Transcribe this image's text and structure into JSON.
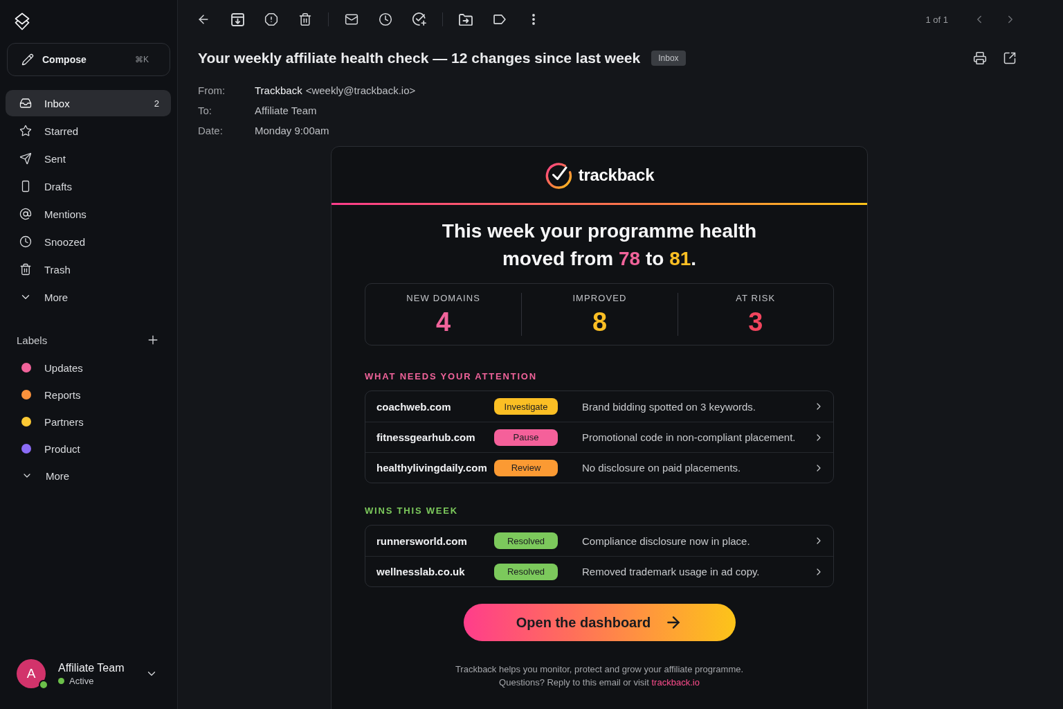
{
  "sidebar": {
    "compose": {
      "label": "Compose",
      "shortcut": "⌘K"
    },
    "nav": [
      {
        "label": "Inbox",
        "count": "2",
        "selected": true
      },
      {
        "label": "Starred",
        "selected": false
      },
      {
        "label": "Sent",
        "selected": false
      },
      {
        "label": "Drafts",
        "selected": false
      },
      {
        "label": "Mentions",
        "selected": false
      },
      {
        "label": "Snoozed",
        "selected": false
      },
      {
        "label": "Trash",
        "selected": false
      }
    ],
    "nav_more": "More",
    "labels_heading": "Labels",
    "labels": [
      {
        "label": "Updates",
        "color": "#f0639a"
      },
      {
        "label": "Reports",
        "color": "#fb923c"
      },
      {
        "label": "Partners",
        "color": "#fcc934"
      },
      {
        "label": "Product",
        "color": "#8b6cf6"
      }
    ],
    "labels_more": "More",
    "account": {
      "initial": "A",
      "name": "Affiliate Team",
      "status": "Active",
      "online": true
    }
  },
  "toolbar": {
    "pager": "1 of 1"
  },
  "message": {
    "subject": "Your weekly affiliate health check — 12 changes since last week",
    "folder_tag": "Inbox",
    "from": {
      "label": "From:",
      "name": "Trackback",
      "address": "<weekly@trackback.io>"
    },
    "to": {
      "label": "To:",
      "value": "Affiliate Team"
    },
    "date": {
      "label": "Date:",
      "value": "Monday 9:00am"
    }
  },
  "email": {
    "brand": "trackback",
    "headline": {
      "before": "This week your programme health moved from",
      "old_score": "78",
      "joiner": "to",
      "new_score": "81",
      "ending": "."
    },
    "stats": [
      {
        "label": "NEW DOMAINS",
        "value": "4",
        "color": "#f0639a"
      },
      {
        "label": "IMPROVED",
        "value": "8",
        "color": "#fbbf24"
      },
      {
        "label": "AT RISK",
        "value": "3",
        "color": "#f2455e"
      }
    ],
    "sections": [
      {
        "kind": "attention",
        "heading": "WHAT NEEDS YOUR ATTENTION",
        "rows": [
          {
            "domain": "coachweb.com",
            "action": "Investigate",
            "color": "#fbbf24",
            "note": "Brand bidding spotted on 3 keywords."
          },
          {
            "domain": "fitnessgearhub.com",
            "action": "Pause",
            "color": "#f5609a",
            "note": "Promotional code in non-compliant placement."
          },
          {
            "domain": "healthylivingdaily.com",
            "action": "Review",
            "color": "#fb9a33",
            "note": "No disclosure on paid placements."
          }
        ]
      },
      {
        "kind": "wins",
        "heading": "WINS THIS WEEK",
        "rows": [
          {
            "domain": "runnersworld.com",
            "action": "Resolved",
            "color": "#7cc95c",
            "note": "Compliance disclosure now in place."
          },
          {
            "domain": "wellnesslab.co.uk",
            "action": "Resolved",
            "color": "#7cc95c",
            "note": "Removed trademark usage in ad copy."
          }
        ]
      }
    ],
    "cta": "Open the dashboard",
    "footer": {
      "line_1": "Trackback helps you monitor, protect and grow your affiliate programme.",
      "line_2": "Questions? Reply to this email or visit",
      "link": "trackback.io"
    }
  }
}
